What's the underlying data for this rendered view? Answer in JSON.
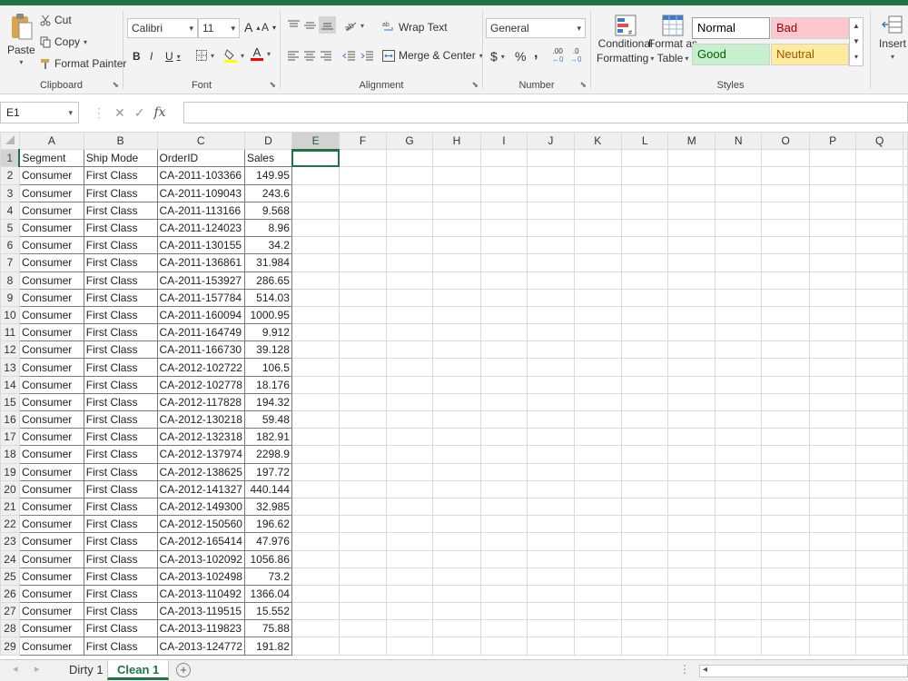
{
  "ribbon": {
    "clipboard": {
      "paste_label": "Paste",
      "cut_label": "Cut",
      "copy_label": "Copy",
      "format_painter_label": "Format Painter",
      "group_label": "Clipboard"
    },
    "font": {
      "name": "Calibri",
      "size": "11",
      "grow_label": "A",
      "shrink_label": "A",
      "bold_label": "B",
      "italic_label": "I",
      "underline_label": "U",
      "font_color_label": "A",
      "group_label": "Font"
    },
    "alignment": {
      "wrap_text_label": "Wrap Text",
      "merge_center_label": "Merge & Center",
      "group_label": "Alignment"
    },
    "number": {
      "format": "General",
      "currency_label": "$",
      "percent_label": "%",
      "comma_label": ",",
      "inc_decimal_label": ".00",
      "dec_decimal_label": ".0",
      "group_label": "Number"
    },
    "styles": {
      "conditional_label_1": "Conditional",
      "conditional_label_2": "Formatting",
      "format_table_label_1": "Format as",
      "format_table_label_2": "Table",
      "normal_label": "Normal",
      "bad_label": "Bad",
      "good_label": "Good",
      "neutral_label": "Neutral",
      "group_label": "Styles"
    },
    "cells": {
      "insert_label": "Insert"
    }
  },
  "formula_bar": {
    "name_box": "E1",
    "fx_label": "fx",
    "value": ""
  },
  "sheet": {
    "column_headers": [
      "A",
      "B",
      "C",
      "D",
      "E",
      "F",
      "G",
      "H",
      "I",
      "J",
      "K",
      "L",
      "M",
      "N",
      "O",
      "P",
      "Q"
    ],
    "rows": [
      {
        "n": "1",
        "a": "Segment",
        "b": "Ship Mode",
        "c": "OrderID",
        "d": "Sales"
      },
      {
        "n": "2",
        "a": "Consumer",
        "b": "First Class",
        "c": "CA-2011-103366",
        "d": "149.95"
      },
      {
        "n": "3",
        "a": "Consumer",
        "b": "First Class",
        "c": "CA-2011-109043",
        "d": "243.6"
      },
      {
        "n": "4",
        "a": "Consumer",
        "b": "First Class",
        "c": "CA-2011-113166",
        "d": "9.568"
      },
      {
        "n": "5",
        "a": "Consumer",
        "b": "First Class",
        "c": "CA-2011-124023",
        "d": "8.96"
      },
      {
        "n": "6",
        "a": "Consumer",
        "b": "First Class",
        "c": "CA-2011-130155",
        "d": "34.2"
      },
      {
        "n": "7",
        "a": "Consumer",
        "b": "First Class",
        "c": "CA-2011-136861",
        "d": "31.984"
      },
      {
        "n": "8",
        "a": "Consumer",
        "b": "First Class",
        "c": "CA-2011-153927",
        "d": "286.65"
      },
      {
        "n": "9",
        "a": "Consumer",
        "b": "First Class",
        "c": "CA-2011-157784",
        "d": "514.03"
      },
      {
        "n": "10",
        "a": "Consumer",
        "b": "First Class",
        "c": "CA-2011-160094",
        "d": "1000.95"
      },
      {
        "n": "11",
        "a": "Consumer",
        "b": "First Class",
        "c": "CA-2011-164749",
        "d": "9.912"
      },
      {
        "n": "12",
        "a": "Consumer",
        "b": "First Class",
        "c": "CA-2011-166730",
        "d": "39.128"
      },
      {
        "n": "13",
        "a": "Consumer",
        "b": "First Class",
        "c": "CA-2012-102722",
        "d": "106.5"
      },
      {
        "n": "14",
        "a": "Consumer",
        "b": "First Class",
        "c": "CA-2012-102778",
        "d": "18.176"
      },
      {
        "n": "15",
        "a": "Consumer",
        "b": "First Class",
        "c": "CA-2012-117828",
        "d": "194.32"
      },
      {
        "n": "16",
        "a": "Consumer",
        "b": "First Class",
        "c": "CA-2012-130218",
        "d": "59.48"
      },
      {
        "n": "17",
        "a": "Consumer",
        "b": "First Class",
        "c": "CA-2012-132318",
        "d": "182.91"
      },
      {
        "n": "18",
        "a": "Consumer",
        "b": "First Class",
        "c": "CA-2012-137974",
        "d": "2298.9"
      },
      {
        "n": "19",
        "a": "Consumer",
        "b": "First Class",
        "c": "CA-2012-138625",
        "d": "197.72"
      },
      {
        "n": "20",
        "a": "Consumer",
        "b": "First Class",
        "c": "CA-2012-141327",
        "d": "440.144"
      },
      {
        "n": "21",
        "a": "Consumer",
        "b": "First Class",
        "c": "CA-2012-149300",
        "d": "32.985"
      },
      {
        "n": "22",
        "a": "Consumer",
        "b": "First Class",
        "c": "CA-2012-150560",
        "d": "196.62"
      },
      {
        "n": "23",
        "a": "Consumer",
        "b": "First Class",
        "c": "CA-2012-165414",
        "d": "47.976"
      },
      {
        "n": "24",
        "a": "Consumer",
        "b": "First Class",
        "c": "CA-2013-102092",
        "d": "1056.86"
      },
      {
        "n": "25",
        "a": "Consumer",
        "b": "First Class",
        "c": "CA-2013-102498",
        "d": "73.2"
      },
      {
        "n": "26",
        "a": "Consumer",
        "b": "First Class",
        "c": "CA-2013-110492",
        "d": "1366.04"
      },
      {
        "n": "27",
        "a": "Consumer",
        "b": "First Class",
        "c": "CA-2013-119515",
        "d": "15.552"
      },
      {
        "n": "28",
        "a": "Consumer",
        "b": "First Class",
        "c": "CA-2013-119823",
        "d": "75.88"
      },
      {
        "n": "29",
        "a": "Consumer",
        "b": "First Class",
        "c": "CA-2013-124772",
        "d": "191.82"
      }
    ]
  },
  "tabs": [
    {
      "label": "Dirty 1",
      "active": false
    },
    {
      "label": "Clean 1",
      "active": true
    }
  ],
  "colors": {
    "accent": "#217346",
    "style_bad_bg": "#ffc7ce",
    "style_bad_fg": "#9c0006",
    "style_good_bg": "#c6efce",
    "style_good_fg": "#006100",
    "style_neutral_bg": "#ffeb9c",
    "style_neutral_fg": "#9c5700"
  }
}
